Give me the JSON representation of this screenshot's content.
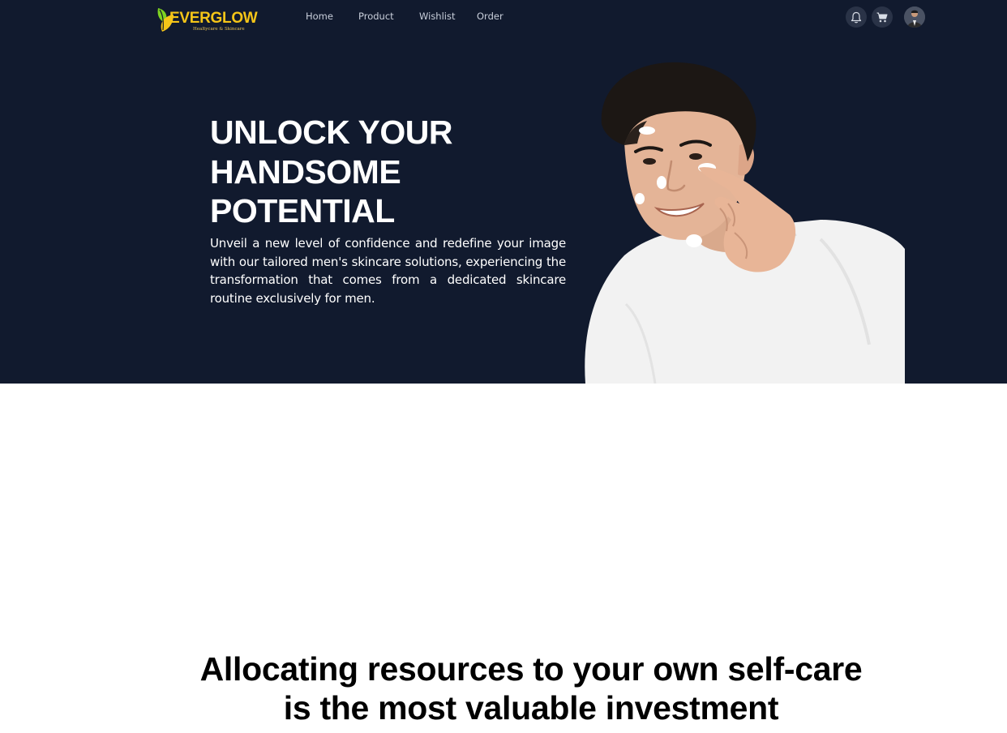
{
  "brand": {
    "name": "EVERGLOW",
    "tagline": "Healtycare & Skincare"
  },
  "nav": {
    "links": [
      "Home",
      "Product",
      "Wishlist",
      "Order"
    ],
    "icons": [
      "bell-icon",
      "cart-icon",
      "user-avatar"
    ]
  },
  "hero": {
    "title": "UNLOCK YOUR\nHANDSOME\nPOTENTIAL",
    "description": "Unveil a new level of confidence and redefine your image with our tailored men's skincare solutions, experiencing the transformation that comes from a dedicated skincare routine exclusively for men.",
    "background_color": "#111a2e"
  },
  "section": {
    "heading_line1": "Allocating resources to your own self-care",
    "heading_line2": "is the most valuable investment"
  },
  "colors": {
    "brand_yellow": "#f5c518",
    "brand_green": "#7ed321",
    "nav_text": "#c9cfdb"
  }
}
